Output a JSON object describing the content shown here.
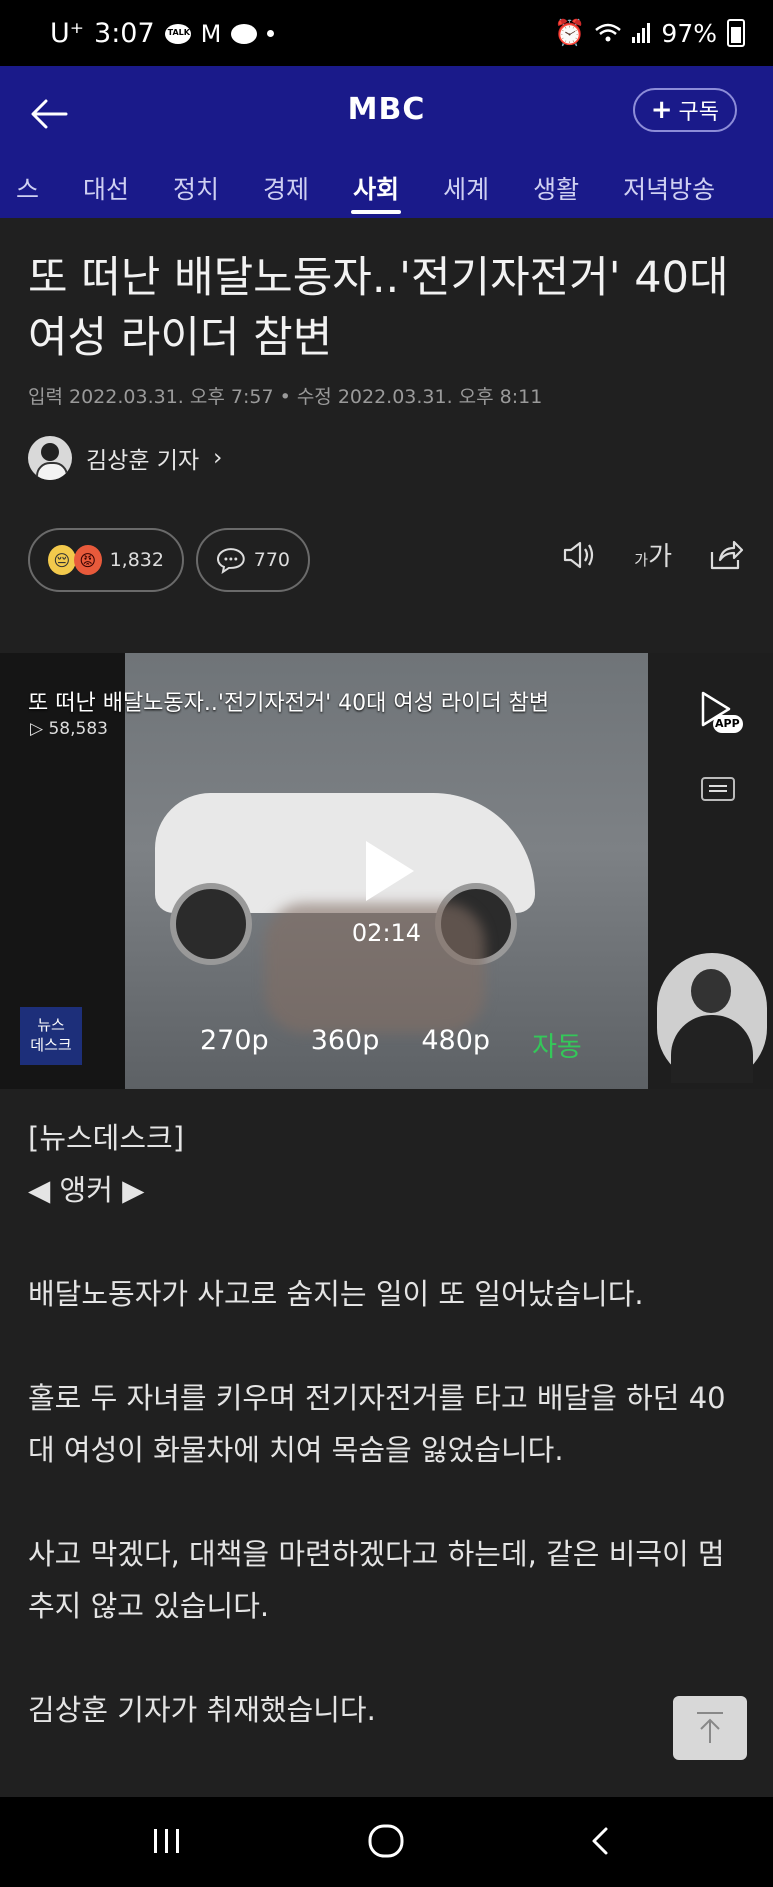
{
  "status_bar": {
    "carrier": "U⁺",
    "time": "3:07",
    "battery": "97%",
    "talk_badge": "TALK"
  },
  "header": {
    "title": "MBC",
    "subscribe_label": "구독",
    "tabs": [
      {
        "label": "스"
      },
      {
        "label": "대선"
      },
      {
        "label": "정치"
      },
      {
        "label": "경제"
      },
      {
        "label": "사회"
      },
      {
        "label": "세계"
      },
      {
        "label": "생활"
      },
      {
        "label": "저녁방송"
      }
    ],
    "active_tab": "사회"
  },
  "article": {
    "headline": "또 떠난 배달노동자..'전기자전거' 40대 여성 라이더 참변",
    "dates": "입력 2022.03.31. 오후 7:57 • 수정 2022.03.31. 오후 8:11",
    "author": "김상훈 기자",
    "reactions_count": "1,832",
    "comments_count": "770",
    "font_size_label_small": "가",
    "font_size_label_large": "가"
  },
  "video": {
    "title": "또 떠난 배달노동자..'전기자전거' 40대 여성 라이더 참변",
    "views": "58,583",
    "duration": "02:14",
    "app_label": "APP",
    "qualities": [
      "270p",
      "360p",
      "480p",
      "자동"
    ],
    "newsdesk_logo": "뉴스\n데스크"
  },
  "body": {
    "source": "[뉴스데스크]",
    "anchor": "◀ 앵커 ▶",
    "paragraphs": [
      "배달노동자가 사고로 숨지는 일이 또 일어났습니다.",
      "홀로 두 자녀를 키우며 전기자전거를 타고 배달을 하던 40대 여성이 화물차에 치여 목숨을 잃었습니다.",
      "사고 막겠다, 대책을 마련하겠다고 하는데, 같은 비극이 멈추지 않고 있습니다.",
      "김상훈 기자가 취재했습니다."
    ]
  }
}
